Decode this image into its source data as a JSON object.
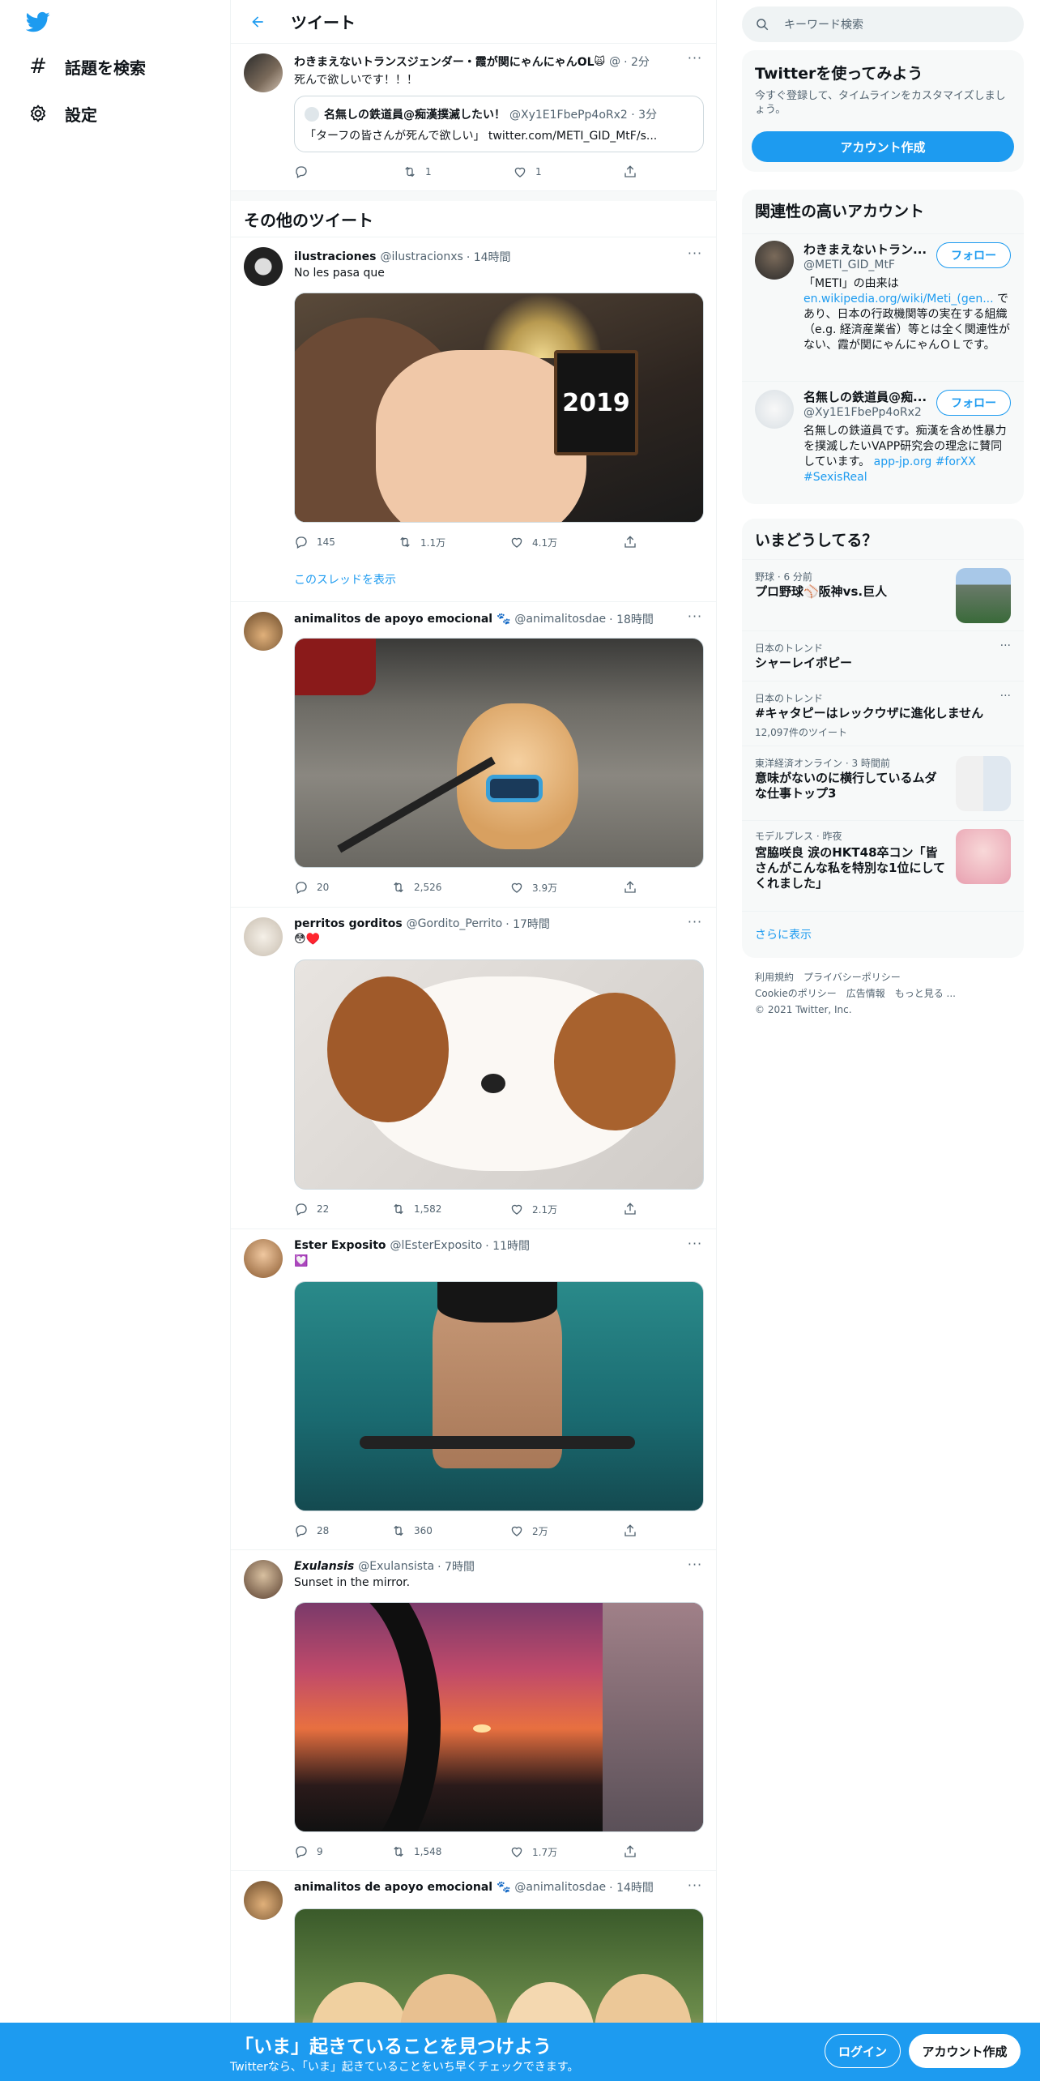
{
  "nav": {
    "explore_label": "話題を検索",
    "settings_label": "設定"
  },
  "header": {
    "title": "ツイート"
  },
  "main_tweet": {
    "name": "わきまえないトランスジェンダー・霞が関にゃんにゃんOL",
    "emoji": "🙀",
    "handle": "@",
    "time": "· 2分",
    "text": "死んで欲しいです！！！",
    "quote": {
      "name": "名無しの鉄道員@痴漢撲滅したい！",
      "handle": "@Xy1E1FbePp4oRx2 · 3分",
      "text": "「ターフの皆さんが死んで欲しい」 twitter.com/METI_GID_MtF/s..."
    },
    "replies": "",
    "retweets": "1",
    "likes": "1"
  },
  "more_tweets_title": "その他のツイート",
  "tweets": [
    {
      "name": "ilustraciones",
      "handle": "@ilustracionxs",
      "time": "· 14時間",
      "text": "No les pasa que",
      "replies": "145",
      "retweets": "1.1万",
      "likes": "4.1万",
      "media_text": "2019",
      "show_thread": "このスレッドを表示"
    },
    {
      "name": "animalitos de apoyo emocional 🐾",
      "handle": "@animalitosdae",
      "time": "· 18時間",
      "text": "",
      "replies": "20",
      "retweets": "2,526",
      "likes": "3.9万"
    },
    {
      "name": "perritos gorditos",
      "handle": "@Gordito_Perrito",
      "time": "· 17時間",
      "text": "😳♥️",
      "replies": "22",
      "retweets": "1,582",
      "likes": "2.1万"
    },
    {
      "name": "Ester Exposito",
      "handle": "@lEsterExposito",
      "time": "· 11時間",
      "text": "💟",
      "replies": "28",
      "retweets": "360",
      "likes": "2万"
    },
    {
      "name": "Exulansis",
      "handle": "@Exulansista",
      "time": "· 7時間",
      "text": "Sunset in the mirror.",
      "replies": "9",
      "retweets": "1,548",
      "likes": "1.7万"
    },
    {
      "name": "animalitos de apoyo emocional 🐾",
      "handle": "@animalitosdae",
      "time": "· 14時間",
      "text": ""
    }
  ],
  "right": {
    "search_placeholder": "キーワード検索",
    "signup_card": {
      "title": "Twitterを使ってみよう",
      "sub": "今すぐ登録して、タイムラインをカスタマイズしましょう。",
      "button": "アカウント作成"
    },
    "relevant": {
      "title": "関連性の高いアカウント",
      "accounts": [
        {
          "name": "わきまえないトラン...",
          "handle": "@METI_GID_MtF",
          "follow": "フォロー",
          "bio_1": "「METI」の由来は",
          "bio_link": "en.wikipedia.org/wiki/Meti_(gen...",
          "bio_2": " であり、日本の行政機関等の実在する組織（e.g. 経済産業省）等とは全く関連性がない、霞が関にゃんにゃんＯＬです。"
        },
        {
          "name": "名無しの鉄道員@痴...",
          "handle": "@Xy1E1FbePp4oRx2",
          "follow": "フォロー",
          "bio_1": "名無しの鉄道員です。痴漢を含め性暴力を撲滅したいVAPP研究会の理念に賛同しています。",
          "bio_link": "app-jp.org",
          "bio_tags": "#forXX #SexisReal"
        }
      ]
    },
    "trends": {
      "title": "いまどうしてる？",
      "items": [
        {
          "meta": "野球 · 6 分前",
          "name": "プロ野球⚾阪神vs.巨人",
          "count": ""
        },
        {
          "meta": "日本のトレンド",
          "name": "シャーレイポピー",
          "count": ""
        },
        {
          "meta": "日本のトレンド",
          "name": "#キャタピーはレックウザに進化しません",
          "count": "12,097件のツイート"
        },
        {
          "meta": "東洋経済オンライン · 3 時間前",
          "name": "意味がないのに横行しているムダな仕事トップ3",
          "count": ""
        },
        {
          "meta": "モデルプレス · 昨夜",
          "name": "宮脇咲良 涙のHKT48卒コン「皆さんがこんな私を特別な1位にしてくれました」",
          "count": ""
        }
      ],
      "show_more": "さらに表示"
    },
    "footer": {
      "line1": "利用規約　プライバシーポリシー",
      "line2": "Cookieのポリシー　広告情報　もっと見る ...",
      "line3": "© 2021 Twitter, Inc."
    }
  },
  "bottom_bar": {
    "title": "「いま」起きていることを見つけよう",
    "sub": "Twitterなら、「いま」起きていることをいち早くチェックできます。",
    "login": "ログイン",
    "signup": "アカウント作成"
  },
  "colors": {
    "accent": "#1d9bf0",
    "text": "#0f1419",
    "muted": "#536471",
    "border": "#eff3f4"
  }
}
